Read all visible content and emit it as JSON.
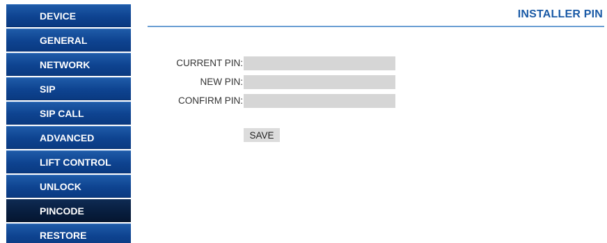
{
  "sidebar": {
    "items": [
      {
        "label": "DEVICE",
        "active": false
      },
      {
        "label": "GENERAL",
        "active": false
      },
      {
        "label": "NETWORK",
        "active": false
      },
      {
        "label": "SIP",
        "active": false
      },
      {
        "label": "SIP CALL",
        "active": false
      },
      {
        "label": "ADVANCED",
        "active": false
      },
      {
        "label": "LIFT CONTROL",
        "active": false
      },
      {
        "label": "UNLOCK",
        "active": false
      },
      {
        "label": "PINCODE",
        "active": true
      },
      {
        "label": "RESTORE",
        "active": false
      }
    ]
  },
  "header": {
    "title": "INSTALLER PIN"
  },
  "form": {
    "current_pin": {
      "label": "CURRENT PIN:",
      "value": ""
    },
    "new_pin": {
      "label": "NEW PIN:",
      "value": ""
    },
    "confirm_pin": {
      "label": "CONFIRM PIN:",
      "value": ""
    },
    "save_label": "SAVE"
  },
  "colors": {
    "nav_blue": "#0e4390",
    "nav_active": "#071d3d",
    "title_blue": "#1a5aa6",
    "rule_blue": "#6b9fd3",
    "input_gray": "#d6d6d6"
  }
}
